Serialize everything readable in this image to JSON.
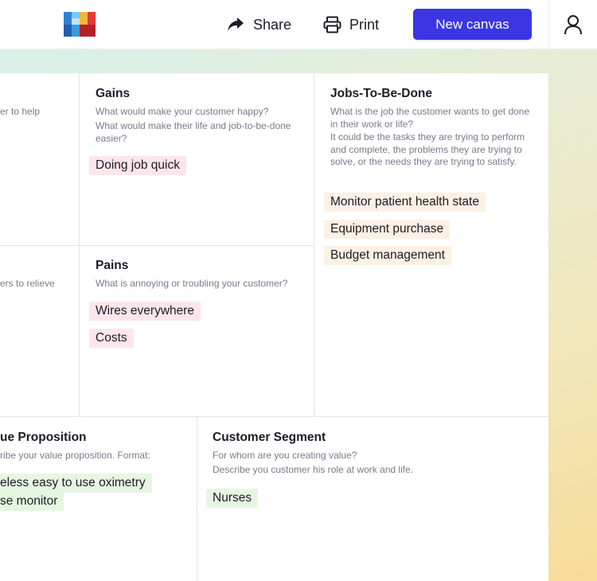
{
  "header": {
    "share_label": "Share",
    "print_label": "Print",
    "new_canvas_label": "New canvas",
    "accent_color": "#3b35e3"
  },
  "canvas": {
    "left_partial_top_desc": "er to help",
    "left_partial_mid_desc": "ers to relieve",
    "gains": {
      "title": "Gains",
      "desc1": "What would make your customer happy?",
      "desc2": "What would make their life and job-to-be-done easier?",
      "items": [
        "Doing job quick"
      ]
    },
    "pains": {
      "title": "Pains",
      "desc": "What is annoying or troubling your customer?",
      "items": [
        "Wires everywhere",
        "Costs"
      ]
    },
    "jobs": {
      "title": "Jobs-To-Be-Done",
      "desc1": "What is the job the customer wants to get done in their work or life?",
      "desc2": "It could be the tasks they are trying to perform and complete, the problems they are trying to solve, or the needs they are trying to satisfy.",
      "items": [
        "Monitor patient health state",
        "Equipment purchase",
        "Budget management"
      ]
    },
    "value_proposition": {
      "title": "ue Proposition",
      "desc": "ribe your value proposition. Format:",
      "items": [
        "eless easy to use oximetry",
        "se monitor"
      ]
    },
    "customer_segment": {
      "title": "Customer Segment",
      "desc1": "For whom are you creating value?",
      "desc2": "Describe you customer his role at work and life.",
      "items": [
        "Nurses"
      ]
    }
  },
  "icons": {
    "logo": "logo-icon",
    "share": "share-icon",
    "print": "printer-icon",
    "user": "user-icon"
  }
}
